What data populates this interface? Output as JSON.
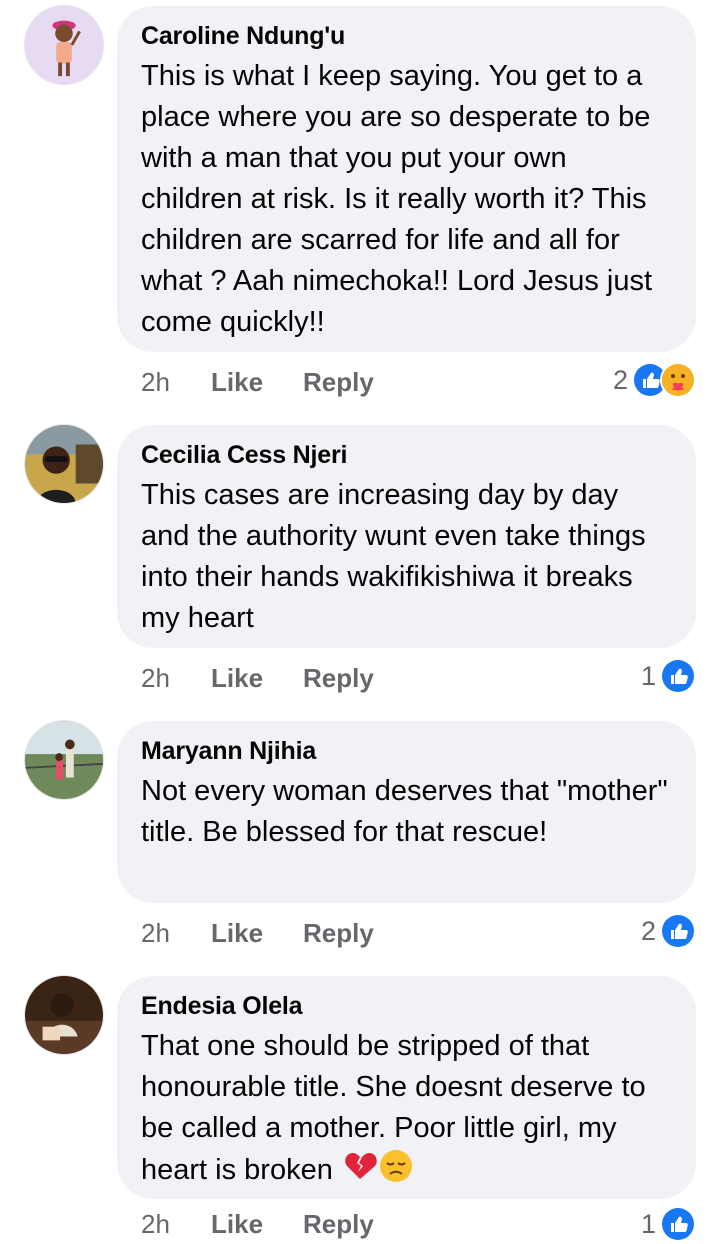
{
  "comments": [
    {
      "author": "Caroline Ndung'u",
      "text": "This is what I keep saying. You get to a place where you are so desperate to be with a man that you put your own children at risk. Is it really worth it? This children are scarred for life and all for what ? Aah nimechoka!! Lord Jesus just come quickly!!",
      "time": "2h",
      "like_label": "Like",
      "reply_label": "Reply",
      "reaction_count": "2",
      "reactions": [
        "like-reaction-icon",
        "care-reaction-icon"
      ]
    },
    {
      "author": "Cecilia Cess Njeri",
      "text": "This cases are increasing day by day and the authority wunt even take things into their hands wakifikishiwa it breaks my heart",
      "time": "2h",
      "like_label": "Like",
      "reply_label": "Reply",
      "reaction_count": "1",
      "reactions": [
        "like-reaction-icon"
      ]
    },
    {
      "author": "Maryann Njihia",
      "text": "Not every woman deserves that \"mother\" title. Be blessed for that rescue!",
      "time": "2h",
      "like_label": "Like",
      "reply_label": "Reply",
      "reaction_count": "2",
      "reactions": [
        "like-reaction-icon"
      ]
    },
    {
      "author": "Endesia Olela",
      "text": "That one should be stripped of that honourable title. She doesnt deserve to be called a mother. Poor little girl, my heart is broken",
      "emojis": [
        "broken-heart-emoji",
        "disappointed-face-emoji"
      ],
      "time": "2h",
      "like_label": "Like",
      "reply_label": "Reply",
      "reaction_count": "1",
      "reactions": [
        "like-reaction-icon"
      ]
    }
  ],
  "colors": {
    "bubble": "#f0f2f5",
    "secondary_text": "#65676b",
    "like_blue": "#1877f2"
  }
}
